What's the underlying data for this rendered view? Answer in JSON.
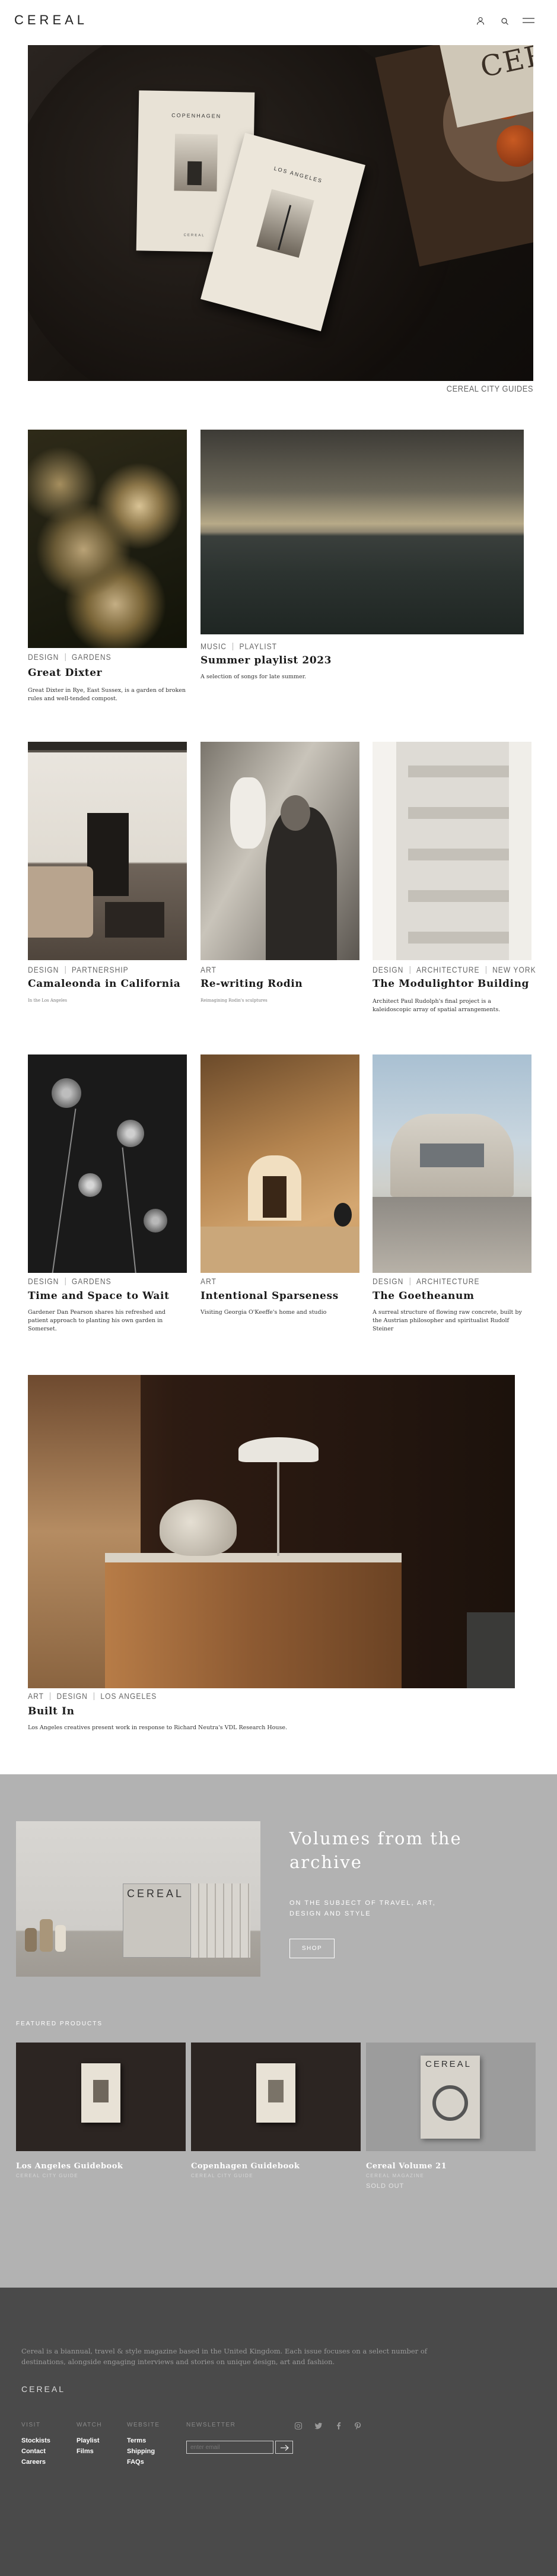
{
  "header": {
    "logo": "CEREAL"
  },
  "hero": {
    "caption": "CEREAL CITY GUIDES",
    "book1_city": "COPENHAGEN",
    "book2_city": "LOS ANGELES",
    "book_series": "CEREAL",
    "brand": "CEREAL"
  },
  "articles": [
    {
      "tags": [
        "DESIGN",
        "GARDENS"
      ],
      "title": "Great Dixter",
      "desc": "Great Dixter in Rye, East Sussex, is a garden of broken rules and well-tended compost."
    },
    {
      "tags": [
        "MUSIC",
        "PLAYLIST"
      ],
      "title": "Summer playlist 2023",
      "desc": "A selection of songs for late summer."
    },
    {
      "tags": [
        "DESIGN",
        "PARTNERSHIP"
      ],
      "title": "Camaleonda in California",
      "desc": "In the Los Angeles"
    },
    {
      "tags": [
        "ART"
      ],
      "title": "Re-writing Rodin",
      "desc": "Reimagining Rodin's sculptures"
    },
    {
      "tags": [
        "DESIGN",
        "ARCHITECTURE",
        "NEW YORK"
      ],
      "title": "The Modulightor Building",
      "desc": "Architect Paul Rudolph's final project is a kaleidoscopic array of spatial arrangements."
    },
    {
      "tags": [
        "DESIGN",
        "GARDENS"
      ],
      "title": "Time and Space to Wait",
      "desc": "Gardener Dan Pearson shares his refreshed and patient approach to planting his own garden in Somerset."
    },
    {
      "tags": [
        "ART"
      ],
      "title": "Intentional Sparseness",
      "desc": "Visiting Georgia O'Keeffe's home and studio"
    },
    {
      "tags": [
        "DESIGN",
        "ARCHITECTURE"
      ],
      "title": "The Goetheanum",
      "desc": "A surreal structure of flowing raw concrete, built by the Austrian philosopher and spiritualist Rudolf Steiner"
    },
    {
      "tags": [
        "ART",
        "DESIGN",
        "LOS ANGELES"
      ],
      "title": "Built In",
      "desc": "Los Angeles creatives present work in response to Richard Neutra's VDL Research House."
    }
  ],
  "archive": {
    "heading": "Volumes from the archive",
    "subheading": "ON THE SUBJECT OF TRAVEL, ART, DESIGN AND STYLE",
    "button": "SHOP",
    "mag_logo": "CEREAL"
  },
  "featured": {
    "heading": "FEATURED PRODUCTS",
    "products": [
      {
        "name": "Los Angeles Guidebook",
        "sub": "CEREAL CITY GUIDE"
      },
      {
        "name": "Copenhagen Guidebook",
        "sub": "CEREAL CITY GUIDE"
      },
      {
        "name": "Cereal Volume 21",
        "sub": "CEREAL MAGAZINE",
        "status": "SOLD OUT",
        "cover_logo": "CEREAL"
      }
    ]
  },
  "footer": {
    "about": "Cereal is a biannual, travel & style magazine based in the United Kingdom. Each issue focuses on a select number of destinations, alongside engaging interviews and stories on unique design, art and fashion.",
    "logo": "CEREAL",
    "columns": [
      {
        "heading": "Visit",
        "links": [
          "Stockists",
          "Contact",
          "Careers"
        ]
      },
      {
        "heading": "Watch",
        "links": [
          "Playlist",
          "Films"
        ]
      },
      {
        "heading": "Website",
        "links": [
          "Terms",
          "Shipping",
          "FAQs"
        ]
      }
    ],
    "newsletter": {
      "heading": "Newsletter",
      "placeholder": "enter email"
    }
  },
  "icons": [
    "user-icon",
    "search-icon",
    "menu-icon",
    "instagram-icon",
    "twitter-icon",
    "facebook-icon",
    "pinterest-icon",
    "arrow-right-icon"
  ]
}
